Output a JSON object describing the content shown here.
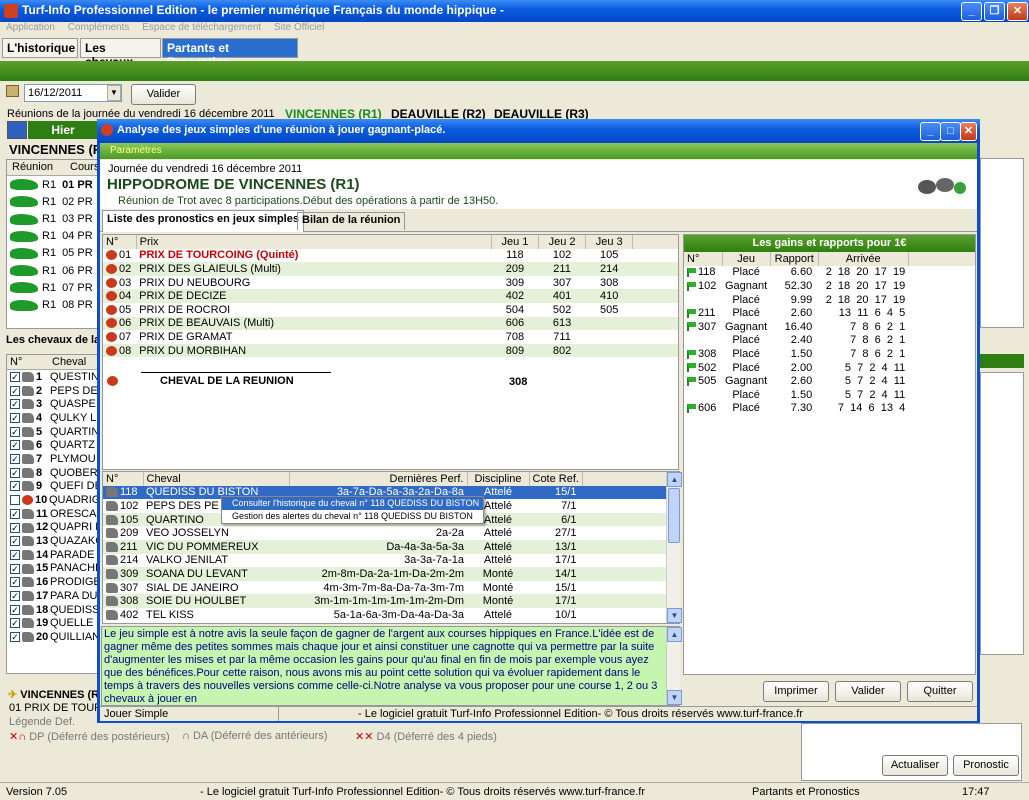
{
  "window": {
    "title": "Turf-Info Professionnel Edition - le premier numérique Français du monde hippique -"
  },
  "menu": [
    "Application",
    "Compléments",
    "Espace de téléchargement",
    "Site Officiel"
  ],
  "tabs": [
    "L'historique",
    "Les chevaux",
    "Partants et Pronostics"
  ],
  "date": {
    "value": "16/12/2011",
    "validate": "Valider"
  },
  "reunions": {
    "label": "Réunions de la journée du vendredi 16 décembre 2011",
    "r1": "VINCENNES (R1)",
    "r2": "DEAUVILLE (R2)",
    "r3": "DEAUVILLE (R3)"
  },
  "left": {
    "hier": "Hier",
    "vincennes": "VINCENNES (R",
    "col_reunion": "Réunion",
    "col_cours": "Cours",
    "reunion_rows": [
      {
        "r": "R1",
        "c": "01 PR"
      },
      {
        "r": "R1",
        "c": "02 PR"
      },
      {
        "r": "R1",
        "c": "03 PR"
      },
      {
        "r": "R1",
        "c": "04 PR"
      },
      {
        "r": "R1",
        "c": "05 PR"
      },
      {
        "r": "R1",
        "c": "06 PR"
      },
      {
        "r": "R1",
        "c": "07 PR"
      },
      {
        "r": "R1",
        "c": "08 PR"
      }
    ],
    "chevaux_label": "Les chevaux de la",
    "col_no": "N°",
    "col_cheval": "Cheval",
    "chevaux": [
      {
        "n": "1",
        "c": "QUESTIN"
      },
      {
        "n": "2",
        "c": "PEPS DE"
      },
      {
        "n": "3",
        "c": "QUASPE"
      },
      {
        "n": "4",
        "c": "QULKY L"
      },
      {
        "n": "5",
        "c": "QUARTIN"
      },
      {
        "n": "6",
        "c": "QUARTZ"
      },
      {
        "n": "7",
        "c": "PLYMOU"
      },
      {
        "n": "8",
        "c": "QUOBER"
      },
      {
        "n": "9",
        "c": "QUEFI DE"
      },
      {
        "n": "10",
        "c": "QUADRIG"
      },
      {
        "n": "11",
        "c": "ORESCA"
      },
      {
        "n": "12",
        "c": "QUAPRI D"
      },
      {
        "n": "13",
        "c": "QUAZAKC"
      },
      {
        "n": "14",
        "c": "PARADE"
      },
      {
        "n": "15",
        "c": "PANACHI"
      },
      {
        "n": "16",
        "c": "PRODIGE"
      },
      {
        "n": "17",
        "c": "PARA DU"
      },
      {
        "n": "18",
        "c": "QUEDISS"
      },
      {
        "n": "19",
        "c": "QUELLE"
      },
      {
        "n": "20",
        "c": "QUILLIAN"
      }
    ],
    "bottom_vincennes": "VINCENNES (R",
    "bottom_prix": "01 PRIX DE TOURC",
    "legende": "Légende Def.",
    "legend": [
      {
        "code": "DP",
        "text": "(Déferré des postérieurs)"
      },
      {
        "code": "DA",
        "text": "(Déferré des antérieurs)"
      },
      {
        "code": "D4",
        "text": "(Déferré des 4 pieds)"
      }
    ]
  },
  "right_buttons": {
    "actualiser": "Actualiser",
    "pronostic": "Pronostic"
  },
  "dialog": {
    "title": "Analyse des jeux simples d'une réunion à jouer gagnant-placé.",
    "menu": "Paramètres",
    "journee": "Journée du vendredi 16 décembre 2011",
    "hippodrome": "HIPPODROME DE  VINCENNES (R1)",
    "info": "Réunion de Trot avec 8 participations.Début des opérations à partir de 13H50.",
    "tab1": "Liste des pronostics en jeux simples",
    "tab2": "Bilan de la réunion",
    "prix_headers": [
      "N°",
      "Prix",
      "Jeu 1",
      "Jeu 2",
      "Jeu 3"
    ],
    "prix": [
      {
        "n": "01",
        "p": "PRIX DE TOURCOING (Quinté)",
        "j1": "118",
        "j2": "102",
        "j3": "105",
        "red": true
      },
      {
        "n": "02",
        "p": "PRIX DES GLAIEULS (Multi)",
        "j1": "209",
        "j2": "211",
        "j3": "214"
      },
      {
        "n": "03",
        "p": "PRIX DU NEUBOURG",
        "j1": "309",
        "j2": "307",
        "j3": "308"
      },
      {
        "n": "04",
        "p": "PRIX DE DECIZE",
        "j1": "402",
        "j2": "401",
        "j3": "410"
      },
      {
        "n": "05",
        "p": "PRIX DE ROCROI",
        "j1": "504",
        "j2": "502",
        "j3": "505"
      },
      {
        "n": "06",
        "p": "PRIX DE BEAUVAIS (Multi)",
        "j1": "606",
        "j2": "613",
        "j3": ""
      },
      {
        "n": "07",
        "p": "PRIX DE GRAMAT",
        "j1": "708",
        "j2": "711",
        "j3": ""
      },
      {
        "n": "08",
        "p": "PRIX DU MORBIHAN",
        "j1": "809",
        "j2": "802",
        "j3": ""
      }
    ],
    "cheval_reunion": "CHEVAL DE LA REUNION",
    "cheval_reunion_val": "308",
    "gains_title": "Les gains et rapports pour 1€",
    "gains_headers": [
      "N°",
      "Jeu",
      "Rapport",
      "Arrivée"
    ],
    "gains": [
      {
        "n": "118",
        "j": "Placé",
        "r": "6.60",
        "a": "2  18  20  17  19",
        "flag": true
      },
      {
        "n": "102",
        "j": "Gagnant",
        "r": "52.30",
        "a": "2  18  20  17  19",
        "flag": true
      },
      {
        "n": "",
        "j": "Placé",
        "r": "9.99",
        "a": "2  18  20  17  19"
      },
      {
        "n": "211",
        "j": "Placé",
        "r": "2.60",
        "a": "13  11  6  4  5",
        "flag": true
      },
      {
        "n": "307",
        "j": "Gagnant",
        "r": "16.40",
        "a": "7  8  6  2  1",
        "flag": true
      },
      {
        "n": "",
        "j": "Placé",
        "r": "2.40",
        "a": "7  8  6  2  1"
      },
      {
        "n": "308",
        "j": "Placé",
        "r": "1.50",
        "a": "7  8  6  2  1",
        "flag": true
      },
      {
        "n": "502",
        "j": "Placé",
        "r": "2.00",
        "a": "5  7  2  4  11",
        "flag": true
      },
      {
        "n": "505",
        "j": "Gagnant",
        "r": "2.60",
        "a": "5  7  2  4  11",
        "flag": true
      },
      {
        "n": "",
        "j": "Placé",
        "r": "1.50",
        "a": "5  7  2  4  11"
      },
      {
        "n": "606",
        "j": "Placé",
        "r": "7.30",
        "a": "7  14  6  13  4",
        "flag": true
      }
    ],
    "chev_headers": [
      "N°",
      "Cheval",
      "Dernières Perf.",
      "Discipline",
      "Cote Ref."
    ],
    "chevaux": [
      {
        "n": "118",
        "c": "QUEDISS DU BISTON",
        "p": "3a-7a-Da-5a-3a-2a-Da-8a",
        "d": "Attelé",
        "k": "15/1"
      },
      {
        "n": "102",
        "c": "PEPS DES PE",
        "p": "",
        "d": "Attelé",
        "k": "7/1"
      },
      {
        "n": "105",
        "c": "QUARTINO",
        "p": "",
        "d": "Attelé",
        "k": "6/1"
      },
      {
        "n": "209",
        "c": "VEO JOSSELYN",
        "p": "2a-2a",
        "d": "Attelé",
        "k": "27/1"
      },
      {
        "n": "211",
        "c": "VIC DU POMMEREUX",
        "p": "Da-4a-3a-5a-3a",
        "d": "Attelé",
        "k": "13/1"
      },
      {
        "n": "214",
        "c": "VALKO JENILAT",
        "p": "3a-3a-7a-1a",
        "d": "Attelé",
        "k": "17/1"
      },
      {
        "n": "309",
        "c": "SOANA DU LEVANT",
        "p": "2m-8m-Da-2a-1m-Da-2m-2m",
        "d": "Monté",
        "k": "14/1"
      },
      {
        "n": "307",
        "c": "SIAL DE JANEIRO",
        "p": "4m-3m-7m-8a-Da-7a-3m-7m",
        "d": "Monté",
        "k": "15/1"
      },
      {
        "n": "308",
        "c": "SOIE DU HOULBET",
        "p": "3m-1m-1m-1m-1m-1m-2m-Dm",
        "d": "Monté",
        "k": "17/1"
      },
      {
        "n": "402",
        "c": "TEL KISS",
        "p": "5a-1a-6a-3m-Da-4a-Da-3a",
        "d": "Attelé",
        "k": "10/1"
      }
    ],
    "context_menu": [
      "Consulter l'historique du cheval n° 118 QUEDISS DU BISTON",
      "Gestion des alertes du cheval n° 118 QUEDISS DU BISTON"
    ],
    "note": "Le jeu simple est à notre avis la seule façon de gagner de l'argent aux courses hippiques en France.L'idée est de gagner même des petites sommes mais chaque jour et ainsi constituer une cagnotte qui va permettre par la suite d'augmenter les mises et par la même occasion les gains pour qu'au final en fin de mois par exemple vous ayez que des bénéfices.Pour cette raison, nous avons mis au point cette solution qui va évoluer rapidement dans le temps à travers des nouvelles versions comme celle-ci.Notre analyse va vous proposer pour une course 1, 2 ou 3 chevaux à jouer en",
    "buttons": {
      "imprimer": "Imprimer",
      "valider": "Valider",
      "quitter": "Quitter"
    },
    "status_left": "Jouer Simple",
    "status_right": "- Le logiciel gratuit Turf-Info Professionnel Edition- © Tous droits réservés www.turf-france.fr"
  },
  "status": {
    "version": "Version 7.05",
    "center": "- Le logiciel gratuit Turf-Info Professionnel Edition- © Tous droits réservés www.turf-france.fr",
    "mode": "Partants et Pronostics",
    "time": "17:47"
  }
}
